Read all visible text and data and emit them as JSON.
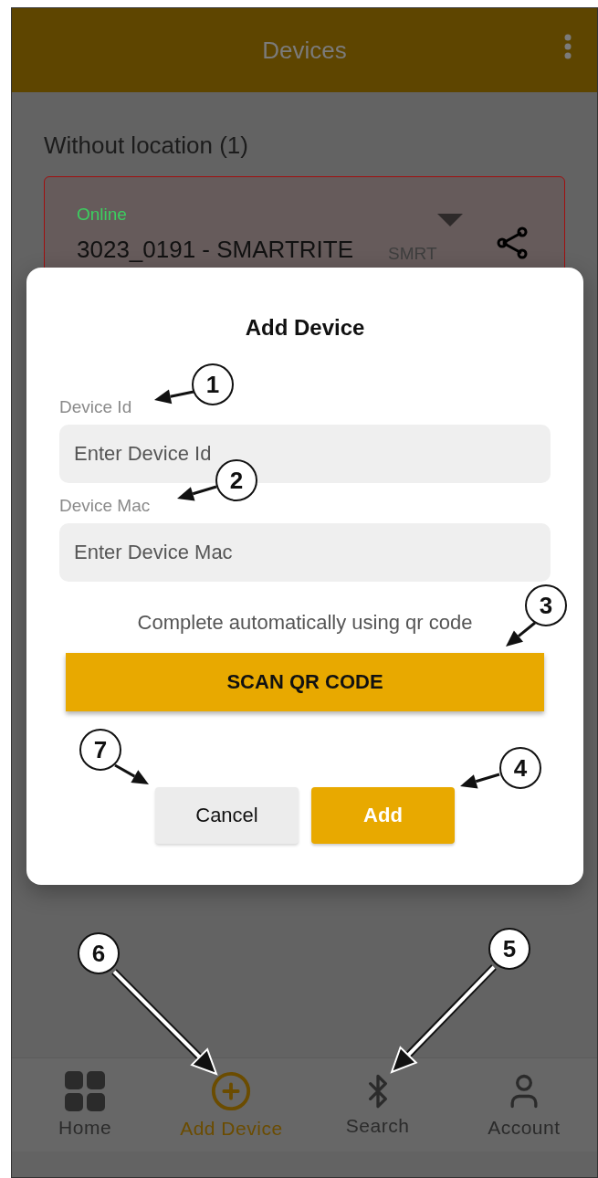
{
  "app_bar": {
    "title": "Devices"
  },
  "section": {
    "title": "Without location (1)"
  },
  "device_card": {
    "status": "Online",
    "name": "3023_0191 - SMARTRITE",
    "type": "SMRT"
  },
  "dialog": {
    "title": "Add Device",
    "fields": [
      {
        "label": "Device Id",
        "placeholder": "Enter Device Id"
      },
      {
        "label": "Device Mac",
        "placeholder": "Enter Device Mac"
      }
    ],
    "hint": "Complete automatically using qr code",
    "scan_button": "SCAN QR CODE",
    "buttons": [
      {
        "label": "Cancel",
        "kind": "secondary"
      },
      {
        "label": "Add",
        "kind": "primary"
      }
    ]
  },
  "bottom_nav": [
    {
      "label": "Home",
      "selected": false
    },
    {
      "label": "Add Device",
      "selected": true
    },
    {
      "label": "Search",
      "selected": false
    },
    {
      "label": "Account",
      "selected": false
    }
  ],
  "callouts": [
    "1",
    "2",
    "3",
    "4",
    "5",
    "6",
    "7"
  ]
}
